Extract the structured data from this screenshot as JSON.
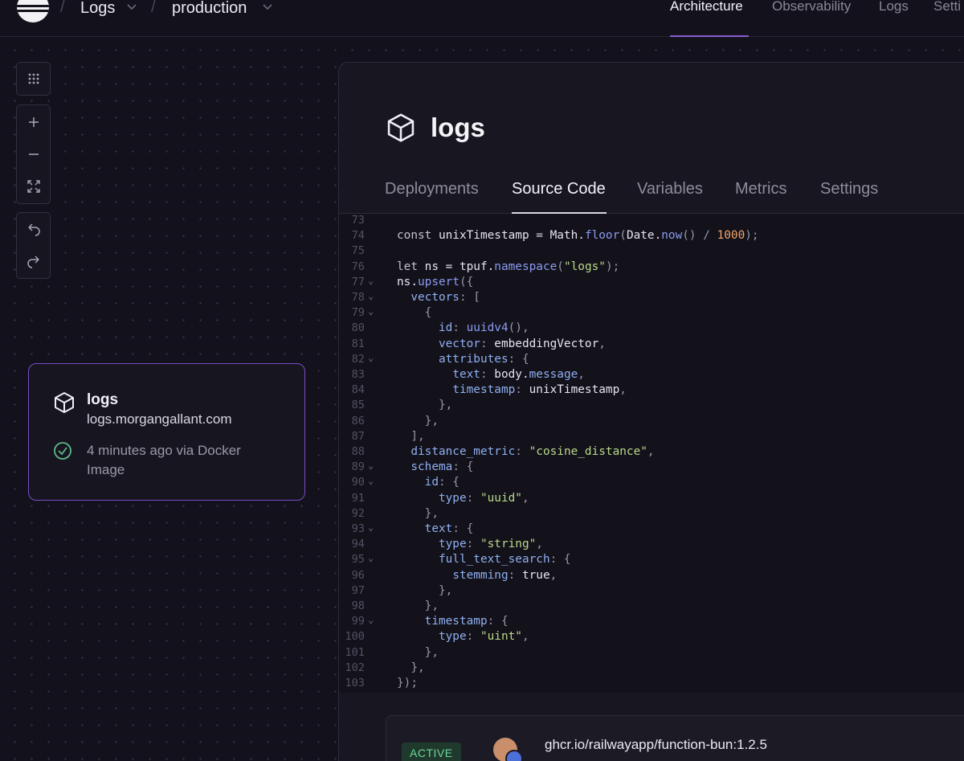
{
  "topbar": {
    "project": "Logs",
    "environment": "production",
    "nav": [
      "Architecture",
      "Observability",
      "Logs",
      "Setti"
    ],
    "active_nav": "Architecture"
  },
  "service_card": {
    "name": "logs",
    "url": "logs.morgangallant.com",
    "status": "4 minutes ago via Docker Image"
  },
  "panel": {
    "title": "logs",
    "tabs": [
      "Deployments",
      "Source Code",
      "Variables",
      "Metrics",
      "Settings"
    ],
    "active_tab": "Source Code"
  },
  "code": {
    "lines": [
      {
        "n": "73",
        "fold": false,
        "tokens": []
      },
      {
        "n": "74",
        "fold": false,
        "tokens": [
          [
            "kw",
            "const "
          ],
          [
            "plain",
            "unixTimestamp = Math."
          ],
          [
            "fn",
            "floor"
          ],
          [
            "punc",
            "("
          ],
          [
            "plain",
            "Date."
          ],
          [
            "fn",
            "now"
          ],
          [
            "punc",
            "() / "
          ],
          [
            "num",
            "1000"
          ],
          [
            "punc",
            ");"
          ]
        ]
      },
      {
        "n": "75",
        "fold": false,
        "tokens": []
      },
      {
        "n": "76",
        "fold": false,
        "tokens": [
          [
            "kw",
            "let "
          ],
          [
            "plain",
            "ns = tpuf."
          ],
          [
            "fn",
            "namespace"
          ],
          [
            "punc",
            "("
          ],
          [
            "str",
            "\"logs\""
          ],
          [
            "punc",
            ");"
          ]
        ]
      },
      {
        "n": "77",
        "fold": true,
        "tokens": [
          [
            "plain",
            "ns."
          ],
          [
            "fn",
            "upsert"
          ],
          [
            "punc",
            "({"
          ]
        ]
      },
      {
        "n": "78",
        "fold": true,
        "tokens": [
          [
            "plain",
            "  "
          ],
          [
            "prop",
            "vectors"
          ],
          [
            "punc",
            ": ["
          ]
        ]
      },
      {
        "n": "79",
        "fold": true,
        "tokens": [
          [
            "punc",
            "    {"
          ]
        ]
      },
      {
        "n": "80",
        "fold": false,
        "tokens": [
          [
            "plain",
            "      "
          ],
          [
            "prop",
            "id"
          ],
          [
            "punc",
            ": "
          ],
          [
            "fn",
            "uuidv4"
          ],
          [
            "punc",
            "(),"
          ]
        ]
      },
      {
        "n": "81",
        "fold": false,
        "tokens": [
          [
            "plain",
            "      "
          ],
          [
            "prop",
            "vector"
          ],
          [
            "punc",
            ": "
          ],
          [
            "plain",
            "embeddingVector"
          ],
          [
            "punc",
            ","
          ]
        ]
      },
      {
        "n": "82",
        "fold": true,
        "tokens": [
          [
            "plain",
            "      "
          ],
          [
            "prop",
            "attributes"
          ],
          [
            "punc",
            ": {"
          ]
        ]
      },
      {
        "n": "83",
        "fold": false,
        "tokens": [
          [
            "plain",
            "        "
          ],
          [
            "prop",
            "text"
          ],
          [
            "punc",
            ": "
          ],
          [
            "plain",
            "body."
          ],
          [
            "prop",
            "message"
          ],
          [
            "punc",
            ","
          ]
        ]
      },
      {
        "n": "84",
        "fold": false,
        "tokens": [
          [
            "plain",
            "        "
          ],
          [
            "prop",
            "timestamp"
          ],
          [
            "punc",
            ": "
          ],
          [
            "plain",
            "unixTimestamp"
          ],
          [
            "punc",
            ","
          ]
        ]
      },
      {
        "n": "85",
        "fold": false,
        "tokens": [
          [
            "punc",
            "      },"
          ]
        ]
      },
      {
        "n": "86",
        "fold": false,
        "tokens": [
          [
            "punc",
            "    },"
          ]
        ]
      },
      {
        "n": "87",
        "fold": false,
        "tokens": [
          [
            "punc",
            "  ],"
          ]
        ]
      },
      {
        "n": "88",
        "fold": false,
        "tokens": [
          [
            "plain",
            "  "
          ],
          [
            "prop",
            "distance_metric"
          ],
          [
            "punc",
            ": "
          ],
          [
            "str",
            "\"cosine_distance\""
          ],
          [
            "punc",
            ","
          ]
        ]
      },
      {
        "n": "89",
        "fold": true,
        "tokens": [
          [
            "plain",
            "  "
          ],
          [
            "prop",
            "schema"
          ],
          [
            "punc",
            ": {"
          ]
        ]
      },
      {
        "n": "90",
        "fold": true,
        "tokens": [
          [
            "plain",
            "    "
          ],
          [
            "prop",
            "id"
          ],
          [
            "punc",
            ": {"
          ]
        ]
      },
      {
        "n": "91",
        "fold": false,
        "tokens": [
          [
            "plain",
            "      "
          ],
          [
            "prop",
            "type"
          ],
          [
            "punc",
            ": "
          ],
          [
            "str",
            "\"uuid\""
          ],
          [
            "punc",
            ","
          ]
        ]
      },
      {
        "n": "92",
        "fold": false,
        "tokens": [
          [
            "punc",
            "    },"
          ]
        ]
      },
      {
        "n": "93",
        "fold": true,
        "tokens": [
          [
            "plain",
            "    "
          ],
          [
            "prop",
            "text"
          ],
          [
            "punc",
            ": {"
          ]
        ]
      },
      {
        "n": "94",
        "fold": false,
        "tokens": [
          [
            "plain",
            "      "
          ],
          [
            "prop",
            "type"
          ],
          [
            "punc",
            ": "
          ],
          [
            "str",
            "\"string\""
          ],
          [
            "punc",
            ","
          ]
        ]
      },
      {
        "n": "95",
        "fold": true,
        "tokens": [
          [
            "plain",
            "      "
          ],
          [
            "prop",
            "full_text_search"
          ],
          [
            "punc",
            ": {"
          ]
        ]
      },
      {
        "n": "96",
        "fold": false,
        "tokens": [
          [
            "plain",
            "        "
          ],
          [
            "prop",
            "stemming"
          ],
          [
            "punc",
            ": "
          ],
          [
            "plain",
            "true"
          ],
          [
            "punc",
            ","
          ]
        ]
      },
      {
        "n": "97",
        "fold": false,
        "tokens": [
          [
            "punc",
            "      },"
          ]
        ]
      },
      {
        "n": "98",
        "fold": false,
        "tokens": [
          [
            "punc",
            "    },"
          ]
        ]
      },
      {
        "n": "99",
        "fold": true,
        "tokens": [
          [
            "plain",
            "    "
          ],
          [
            "prop",
            "timestamp"
          ],
          [
            "punc",
            ": {"
          ]
        ]
      },
      {
        "n": "100",
        "fold": false,
        "tokens": [
          [
            "plain",
            "      "
          ],
          [
            "prop",
            "type"
          ],
          [
            "punc",
            ": "
          ],
          [
            "str",
            "\"uint\""
          ],
          [
            "punc",
            ","
          ]
        ]
      },
      {
        "n": "101",
        "fold": false,
        "tokens": [
          [
            "punc",
            "    },"
          ]
        ]
      },
      {
        "n": "102",
        "fold": false,
        "tokens": [
          [
            "punc",
            "  },"
          ]
        ]
      },
      {
        "n": "103",
        "fold": false,
        "tokens": [
          [
            "punc",
            "});"
          ]
        ]
      }
    ]
  },
  "deployment": {
    "status": "ACTIVE",
    "image": "ghcr.io/railwayapp/function-bun:1.2.5"
  },
  "colors": {
    "accent": "#8a5cd1",
    "card_border": "#7b4cc4",
    "success": "#6fd39a"
  }
}
